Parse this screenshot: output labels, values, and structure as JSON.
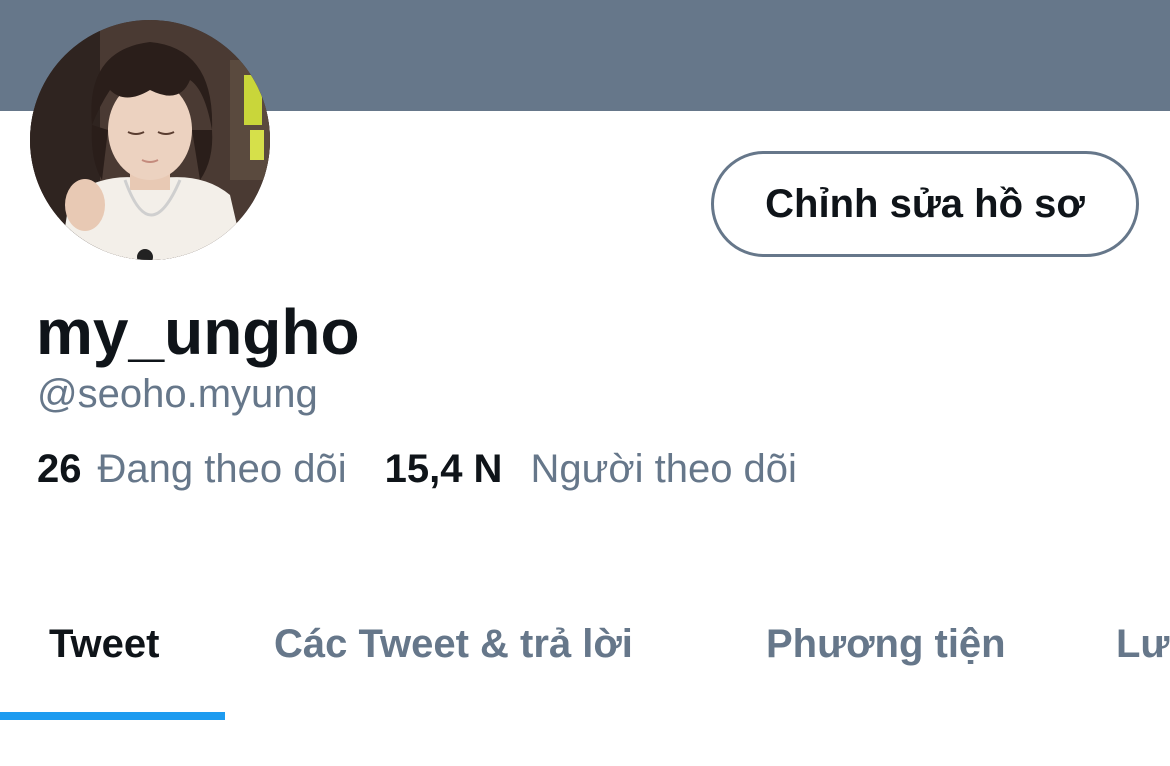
{
  "profile": {
    "display_name": "my_ungho",
    "handle": "@seoho.myung",
    "edit_button_label": "Chỉnh sửa hồ sơ",
    "avatar_icon": "profile-photo"
  },
  "stats": {
    "following_count": "26",
    "following_label": "Đang theo dõi",
    "followers_count": "15,4 N",
    "followers_label": "Người theo dõi"
  },
  "tabs": [
    {
      "label": "Tweet",
      "active": true
    },
    {
      "label": "Các Tweet & trả lời",
      "active": false
    },
    {
      "label": "Phương tiện",
      "active": false
    },
    {
      "label": "Lư",
      "active": false
    }
  ],
  "colors": {
    "banner": "#66778a",
    "accent": "#1d9bf0",
    "text_primary": "#0f1419",
    "text_secondary": "#66778a"
  }
}
